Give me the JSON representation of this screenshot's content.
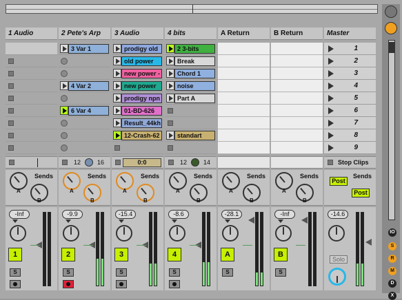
{
  "tracks": [
    {
      "name": "1 Audio",
      "num": "1",
      "vol": "-Inf",
      "status": {
        "mode": "bar",
        "left": "",
        "right": ""
      },
      "clips": [
        {
          "type": "empty"
        },
        {
          "type": "stop"
        },
        {
          "type": "stop"
        },
        {
          "type": "stop"
        },
        {
          "type": "stop"
        },
        {
          "type": "stop"
        },
        {
          "type": "stop"
        },
        {
          "type": "stop"
        },
        {
          "type": "stop"
        }
      ],
      "meters": [
        0,
        0
      ],
      "orange_sends": false,
      "arm": "dot"
    },
    {
      "name": "2 Pete's Arp",
      "num": "2",
      "vol": "-9.9",
      "status": {
        "mode": "numbers",
        "left": "12",
        "right": "16",
        "dot": "blue"
      },
      "clips": [
        {
          "type": "clip",
          "label": "3 Var 1",
          "color": "#8fb0d8"
        },
        {
          "type": "rec"
        },
        {
          "type": "rec"
        },
        {
          "type": "clip",
          "label": "4 Var 2",
          "color": "#8fb0d8"
        },
        {
          "type": "rec"
        },
        {
          "type": "clip",
          "label": "6 Var 4",
          "color": "#8fb0d8",
          "playing": true
        },
        {
          "type": "rec"
        },
        {
          "type": "rec"
        },
        {
          "type": "rec"
        }
      ],
      "meters": [
        0.37,
        0.37
      ],
      "orange_sends": true,
      "arm": "red"
    },
    {
      "name": "3 Audio",
      "num": "3",
      "vol": "-15.4",
      "status": {
        "mode": "clock",
        "left": "0:0"
      },
      "clips": [
        {
          "type": "clip",
          "label": "prodigy old",
          "color": "#8fa8e0"
        },
        {
          "type": "clip",
          "label": "old power",
          "color": "#28b8e8"
        },
        {
          "type": "clip",
          "label": "new power -",
          "color": "#f060a0"
        },
        {
          "type": "clip",
          "label": "new power",
          "color": "#20a890"
        },
        {
          "type": "clip",
          "label": "prodigy npn",
          "color": "#b090d8"
        },
        {
          "type": "clip",
          "label": "01-BD-626",
          "color": "#e070c8"
        },
        {
          "type": "clip",
          "label": "Result_44kh",
          "color": "#90a8d8"
        },
        {
          "type": "clip",
          "label": "12-Crash-62",
          "color": "#c8b070",
          "playing": true
        },
        {
          "type": "stop"
        }
      ],
      "meters": [
        0.3,
        0.3
      ],
      "orange_sends": true,
      "arm": "dot"
    },
    {
      "name": "4 bits",
      "num": "4",
      "vol": "-8.6",
      "status": {
        "mode": "numbers",
        "left": "12",
        "right": "14",
        "dot": "green"
      },
      "clips": [
        {
          "type": "clip",
          "label": "2 3-bits",
          "color": "#40b040",
          "playing": true
        },
        {
          "type": "clip",
          "label": "Break",
          "color": "#d8d8d8"
        },
        {
          "type": "clip",
          "label": "Chord 1",
          "color": "#90b0e0"
        },
        {
          "type": "clip",
          "label": "noise",
          "color": "#90b0e0"
        },
        {
          "type": "clip",
          "label": "Part A",
          "color": "#d8d8d8"
        },
        {
          "type": "stop"
        },
        {
          "type": "stop"
        },
        {
          "type": "clip",
          "label": "standart",
          "color": "#c8b070"
        },
        {
          "type": "stop"
        }
      ],
      "meters": [
        0.32,
        0.32
      ],
      "orange_sends": false,
      "arm": "note"
    }
  ],
  "returns": [
    {
      "name": "A Return",
      "num": "A",
      "vol": "-28.1",
      "meters": [
        0.18,
        0.18
      ]
    },
    {
      "name": "B Return",
      "num": "B",
      "vol": "-Inf",
      "meters": [
        0,
        0
      ]
    }
  ],
  "master": {
    "name": "Master",
    "vol": "-14.6",
    "stop_clips": "Stop Clips",
    "post": "Post",
    "solo": "Solo",
    "scenes": [
      "1",
      "2",
      "3",
      "4",
      "5",
      "6",
      "7",
      "8",
      "9"
    ],
    "meters": [
      0.3,
      0.3
    ]
  },
  "labels": {
    "sends": "Sends",
    "knob_a": "A",
    "knob_b": "B",
    "solo_btn": "S"
  },
  "sidebar": {
    "io": "IO",
    "s": "S",
    "r": "R",
    "m": "M",
    "d": "D",
    "x": "X"
  }
}
